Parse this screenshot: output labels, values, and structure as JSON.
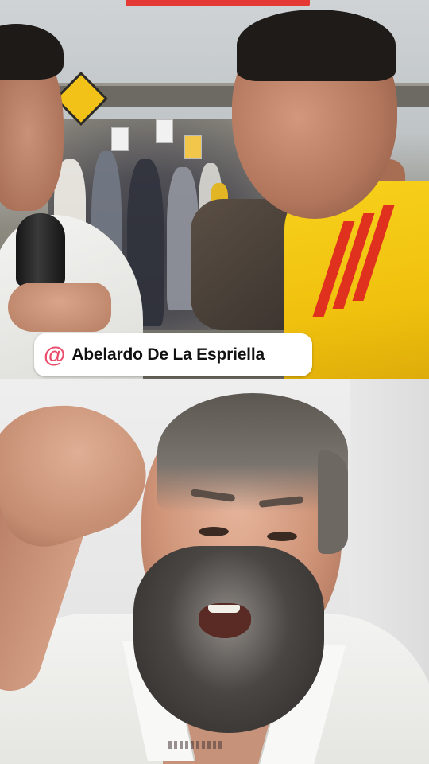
{
  "top_video": {
    "name_tag": {
      "icon": "@",
      "text": "Abelardo De La Espriella"
    }
  },
  "colors": {
    "name_tag_icon": "#ea4c6c",
    "top_accent_bar": "#e53935",
    "jersey_yellow": "#f7d11c",
    "jersey_stripe": "#e0311f"
  },
  "icons": {
    "name_tag_icon": "at-sign-icon"
  }
}
